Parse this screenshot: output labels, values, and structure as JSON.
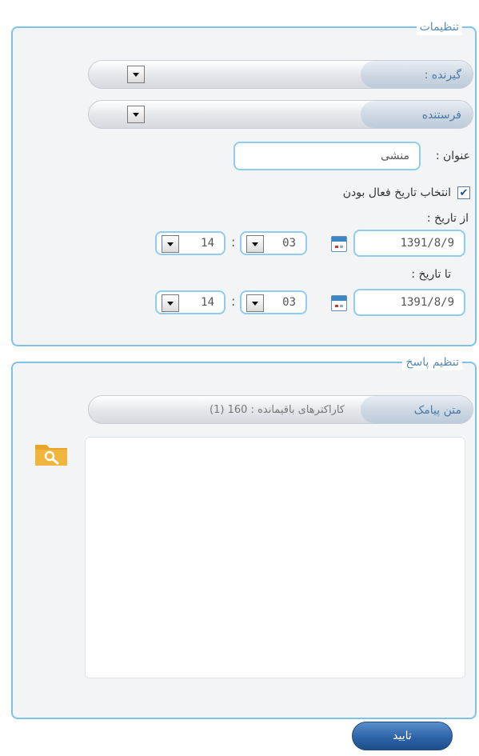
{
  "settings": {
    "legend": "تنظیمات",
    "receiver_label": "گیرنده :",
    "sender_label": "فرستنده",
    "title_label": "عنوان :",
    "title_value": "منشی",
    "enable_date_label": "انتخاب تاریخ فعال بودن",
    "enable_date_checked": true,
    "from_date": {
      "label": "از تاریخ :",
      "date": "1391/8/9",
      "minute": "03",
      "hour": "14"
    },
    "to_date": {
      "label": "تا تاریخ :",
      "date": "1391/8/9",
      "minute": "03",
      "hour": "14"
    }
  },
  "reply": {
    "legend": "تنظیم پاسخ",
    "sms_text_label": "متن پیامک",
    "remaining_chars": "کاراکترهای باقیمانده : 160 (1)"
  },
  "submit_label": "تایید",
  "icons": {
    "dropdown": "dropdown-arrow-icon",
    "calendar": "calendar-icon",
    "folder_search": "folder-search-icon"
  },
  "colors": {
    "border": "#7ec3e6",
    "accent": "#2d64a8",
    "folder": "#e8a52a"
  }
}
